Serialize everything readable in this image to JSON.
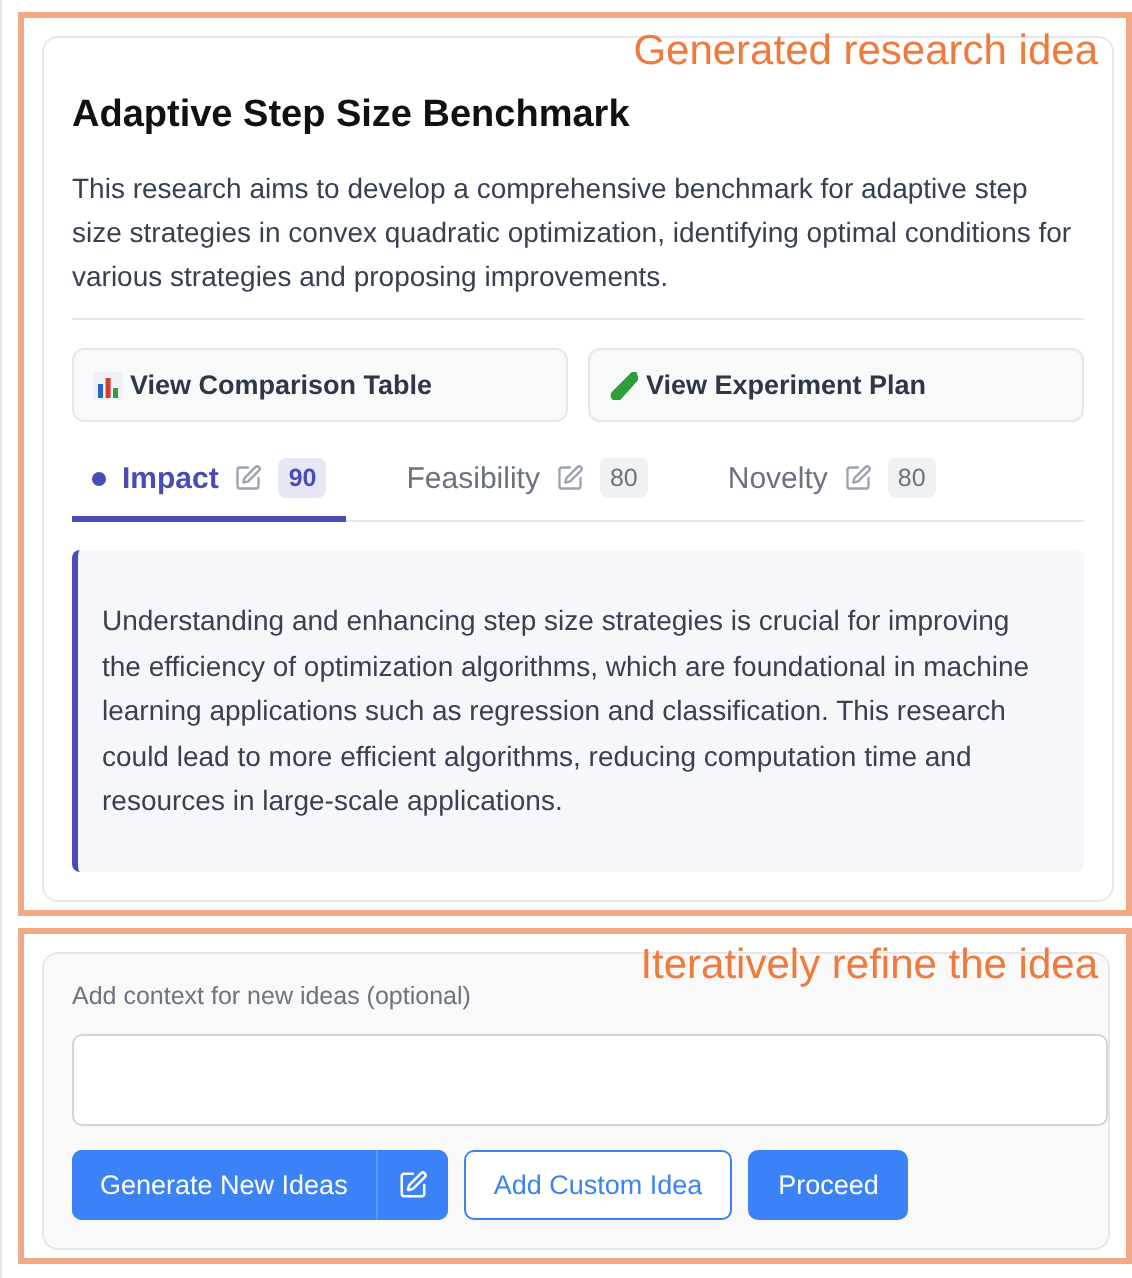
{
  "idea_section": {
    "annotation": "Generated research idea",
    "title": "Adaptive Step Size Benchmark",
    "description": "This research aims to develop a comprehensive benchmark for adaptive step size strategies in convex quadratic optimization, identifying optimal conditions for various strategies and proposing improvements.",
    "actions": [
      {
        "kind": "chart",
        "label": "View Comparison Table"
      },
      {
        "kind": "tube",
        "label": "View Experiment Plan"
      }
    ],
    "tabs": [
      {
        "label": "Impact",
        "score": "90",
        "selected": true
      },
      {
        "label": "Feasibility",
        "score": "80",
        "selected": false
      },
      {
        "label": "Novelty",
        "score": "80",
        "selected": false
      }
    ],
    "tab_content": "Understanding and enhancing step size strategies is crucial for improving the efficiency of optimization algorithms, which are foundational in machine learning applications such as regression and classification. This research could lead to more efficient algorithms, reducing computation time and resources in large-scale applications."
  },
  "refine_section": {
    "annotation": "Iteratively refine the idea",
    "context_label": "Add context for new ideas (optional)",
    "buttons": [
      {
        "kind": "split",
        "label": "Generate New Ideas"
      },
      {
        "kind": "outline",
        "label": "Add Custom Idea"
      },
      {
        "kind": "primary",
        "label": "Proceed"
      }
    ]
  }
}
